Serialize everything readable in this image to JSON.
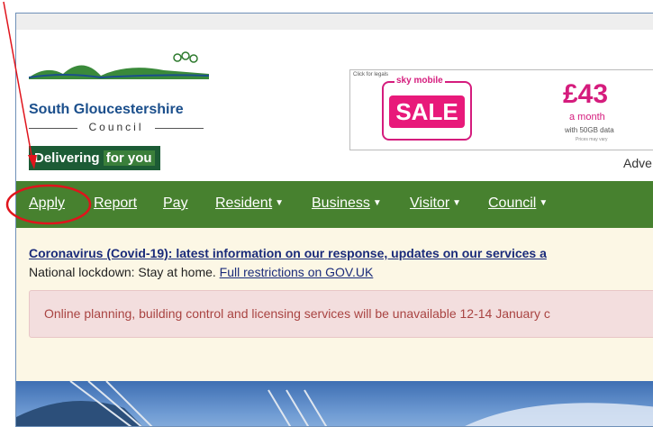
{
  "header": {
    "council_name": "South Gloucestershire",
    "council_sub": "Council",
    "strap_a": "Delivering",
    "strap_b": "for you"
  },
  "ad": {
    "legal": "Click for legals",
    "brand": "sky mobile",
    "sale": "SALE",
    "price": "£43",
    "period": "a month",
    "data": "with 50GB data",
    "note": "Prices may vary",
    "label": "Adve"
  },
  "nav": {
    "apply": "Apply",
    "report": "Report",
    "pay": "Pay",
    "resident": "Resident",
    "business": "Business",
    "visitor": "Visitor",
    "council": "Council"
  },
  "alerts": {
    "covid_link": "Coronavirus (Covid-19): latest information on our response, updates on our services a",
    "lockdown_text": "National lockdown: Stay at home. ",
    "lockdown_link": "Full restrictions on GOV.UK",
    "warning": "Online planning, building control and licensing services will be unavailable 12-14 January c"
  },
  "colors": {
    "nav_green": "#47812f",
    "alert_bg": "#fcf7e5",
    "warning_bg": "#f3dede",
    "annotation_red": "#e0141c"
  },
  "icons": [
    "hills-logo-icon",
    "chevron-down-icon",
    "annotation-arrow-icon",
    "annotation-circle-icon"
  ]
}
